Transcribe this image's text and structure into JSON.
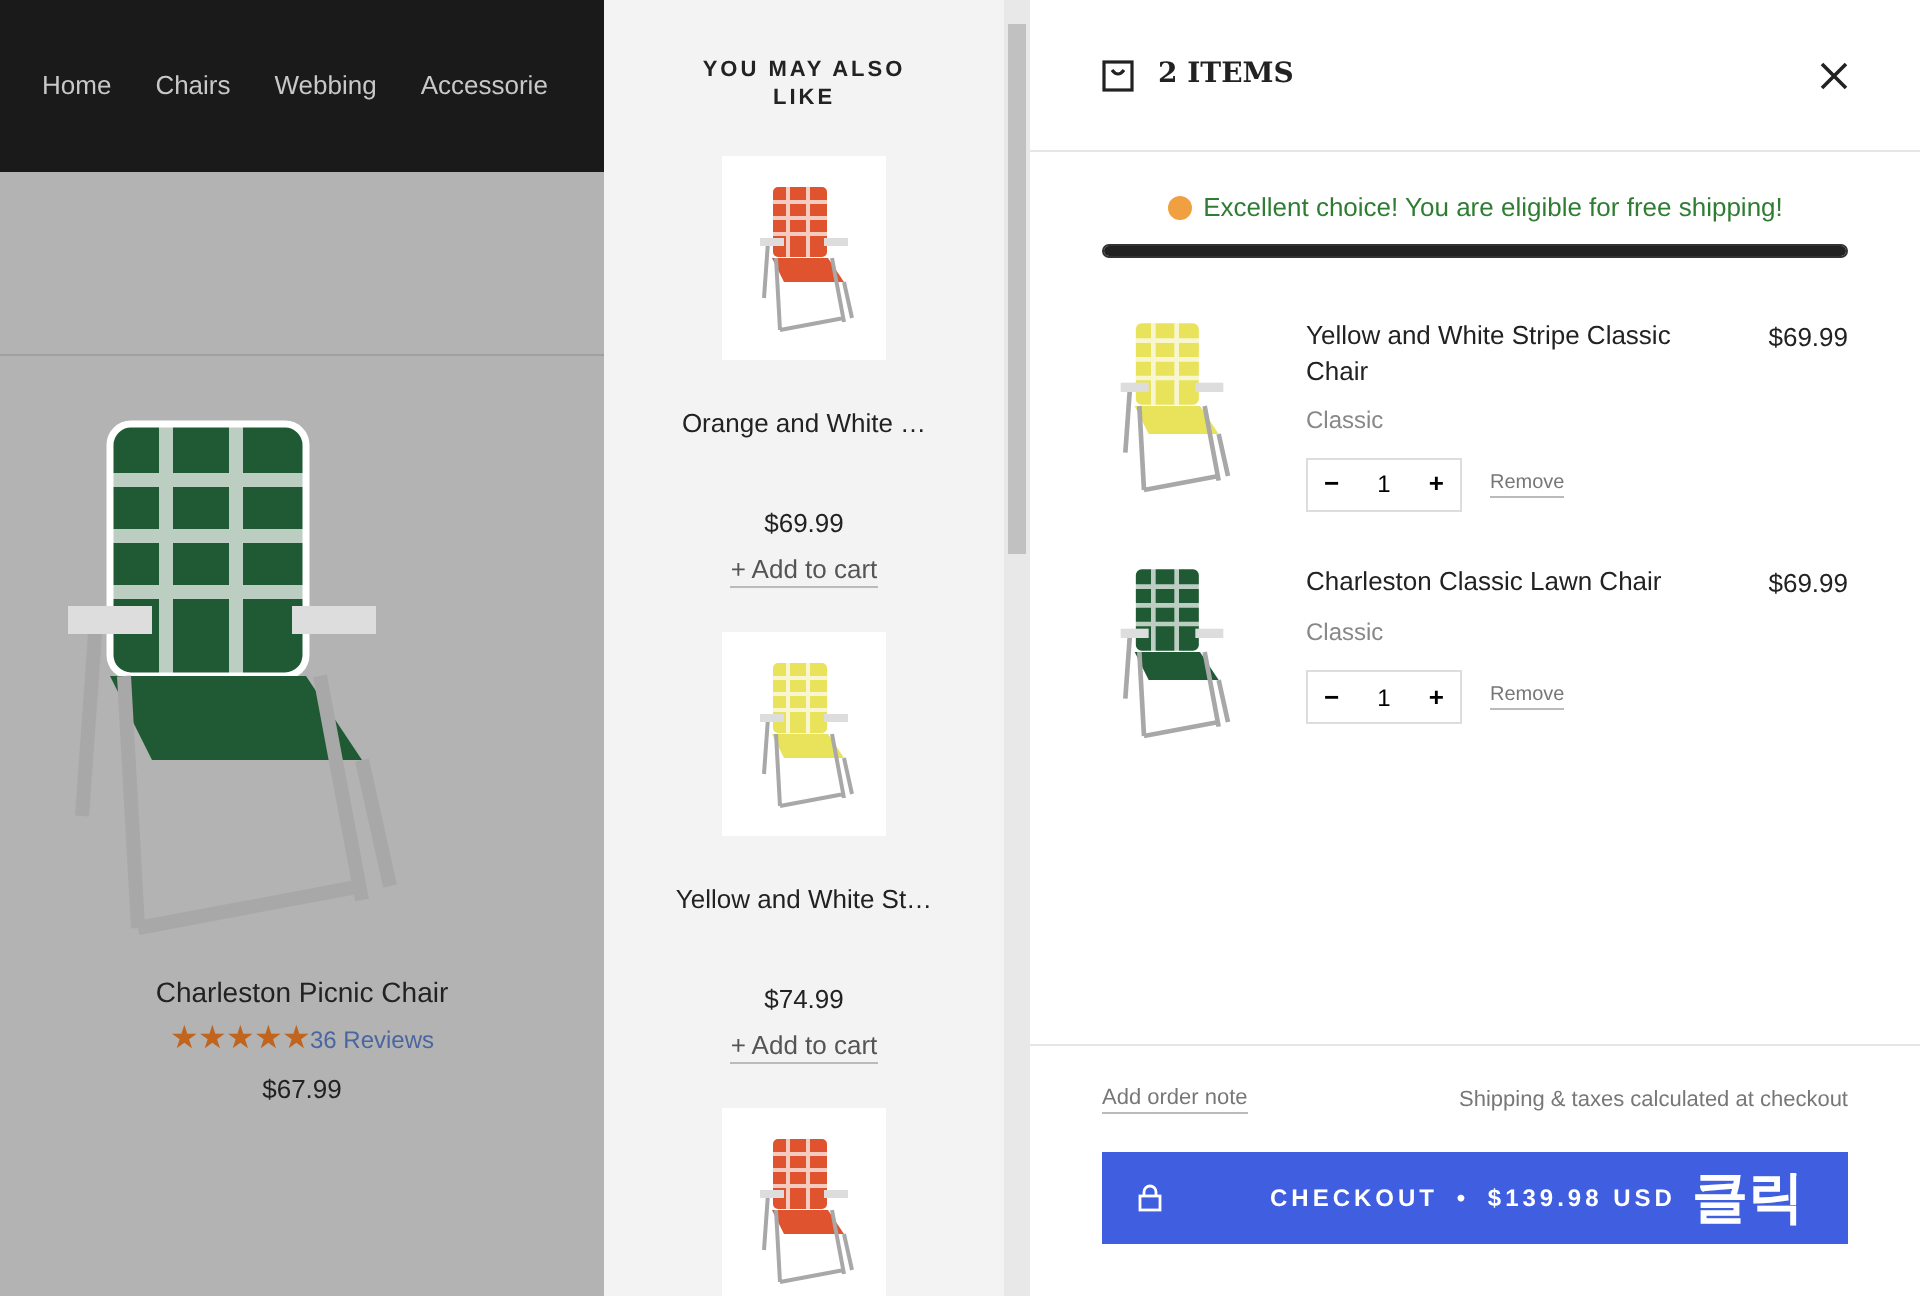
{
  "nav": {
    "items": [
      {
        "label": "Home"
      },
      {
        "label": "Chairs"
      },
      {
        "label": "Webbing"
      },
      {
        "label": "Accessorie"
      }
    ]
  },
  "featured": {
    "name": "Charleston Picnic Chair",
    "stars": 5,
    "reviews": "36 Reviews",
    "price": "$67.99",
    "color": "#1f5a34"
  },
  "recommendations": {
    "title": "YOU MAY ALSO LIKE",
    "items": [
      {
        "name": "Orange and White …",
        "price": "$69.99",
        "action": "+ Add to cart",
        "color": "#e0532f"
      },
      {
        "name": "Yellow and White St…",
        "price": "$74.99",
        "action": "+ Add to cart",
        "color": "#e8e35a"
      },
      {
        "color": "#e0532f"
      }
    ]
  },
  "cart": {
    "title": "2 ITEMS",
    "shipping_message": "Excellent choice! You are eligible for free shipping!",
    "shipping_progress": {
      "level": 1
    },
    "items": [
      {
        "name": "Yellow and White Stripe Classic Chair",
        "variant": "Classic",
        "price": "$69.99",
        "quantity": "1",
        "minus": "−",
        "plus": "+",
        "remove": "Remove",
        "color": "#e8e35a"
      },
      {
        "name": "Charleston Classic Lawn Chair",
        "variant": "Classic",
        "price": "$69.99",
        "quantity": "1",
        "minus": "−",
        "plus": "+",
        "remove": "Remove",
        "color": "#1f5a34"
      }
    ],
    "order_note": "Add order note",
    "taxes_note": "Shipping & taxes calculated at checkout",
    "checkout": {
      "label": "CHECKOUT",
      "separator": "•",
      "total": "$139.98 USD"
    },
    "annotation": "클릭"
  }
}
